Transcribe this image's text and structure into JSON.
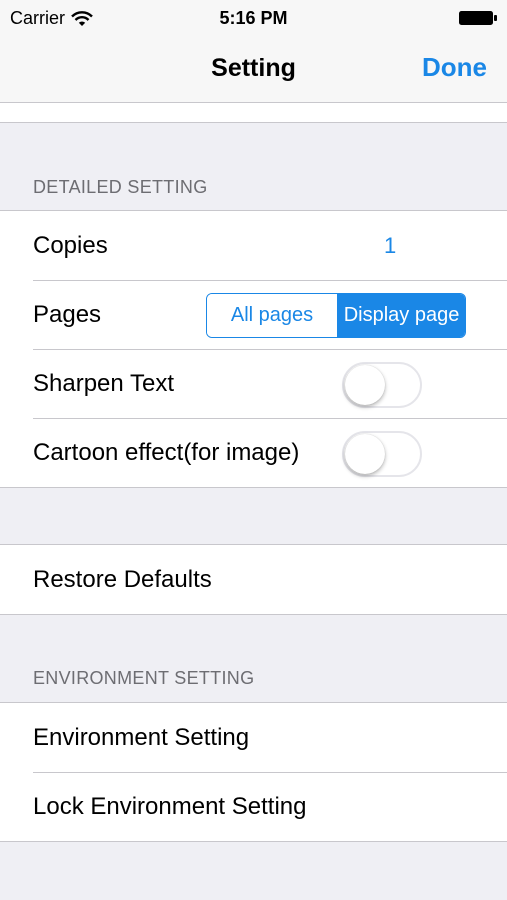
{
  "status": {
    "carrier": "Carrier",
    "time": "5:16 PM"
  },
  "nav": {
    "title": "Setting",
    "done_label": "Done"
  },
  "detailed": {
    "header": "DETAILED SETTING",
    "copies_label": "Copies",
    "copies_value": "1",
    "pages_label": "Pages",
    "pages_options": [
      "All pages",
      "Display page"
    ],
    "pages_selected": "Display page",
    "sharpen_label": "Sharpen Text",
    "sharpen_on": false,
    "cartoon_label": "Cartoon effect(for image)",
    "cartoon_on": false
  },
  "restore": {
    "label": "Restore Defaults"
  },
  "environment": {
    "header": "ENVIRONMENT SETTING",
    "items": [
      "Environment Setting",
      "Lock Environment Setting"
    ]
  },
  "colors": {
    "accent": "#1a87e6",
    "background": "#efeff4",
    "separator": "#c8c7cc"
  }
}
